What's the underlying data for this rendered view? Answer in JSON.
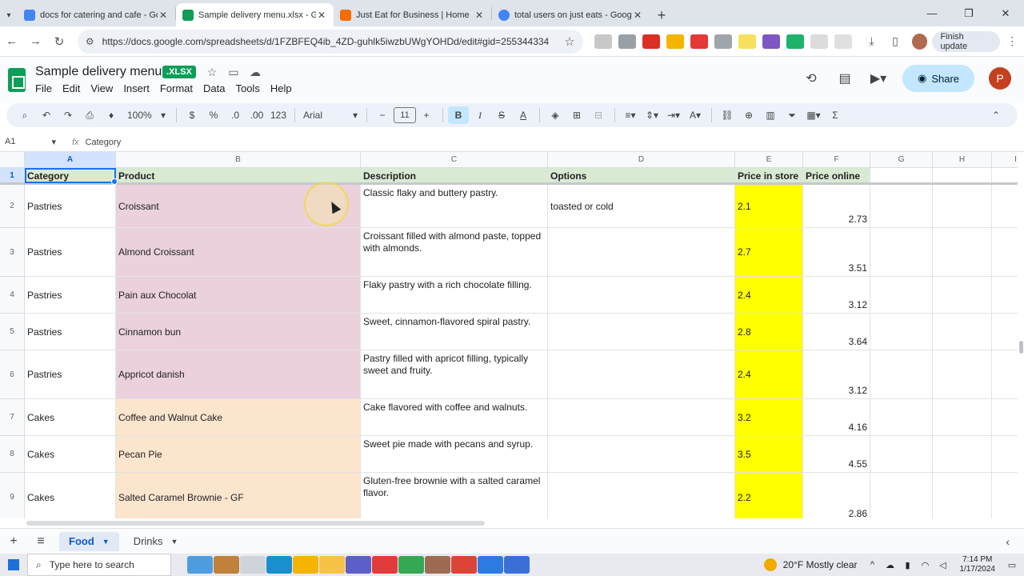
{
  "browser": {
    "tabs": [
      {
        "title": "docs for catering and cafe - Go",
        "color": "#4285f4",
        "active": false
      },
      {
        "title": "Sample delivery menu.xlsx - Go",
        "color": "#0f9d58",
        "active": true
      },
      {
        "title": "Just Eat for Business | Home",
        "color": "#f36d00",
        "active": false
      },
      {
        "title": "total users on just eats - Googl",
        "color": "#4285f4",
        "active": false
      }
    ],
    "url": "https://docs.google.com/spreadsheets/d/1FZBFEQ4ib_4ZD-guhlk5iwzbUWgYOHDd/edit#gid=255344334",
    "finish_update": "Finish update",
    "close_glyph": "✕",
    "new_tab_glyph": "+"
  },
  "doc": {
    "title": "Sample delivery menu",
    "badge": ".XLSX",
    "menu": [
      "File",
      "Edit",
      "View",
      "Insert",
      "Format",
      "Data",
      "Tools",
      "Help"
    ],
    "share_label": "Share",
    "profile_initial": "P"
  },
  "toolbar": {
    "zoom": "100%",
    "currency": "$",
    "percent": "%",
    "dec_decrease": ".0",
    "dec_increase": ".00",
    "number_format": "123",
    "font": "Arial",
    "font_size": "11",
    "bold": "B",
    "italic": "I",
    "sigma": "Σ"
  },
  "formula_bar": {
    "cell_ref": "A1",
    "content": "Category",
    "fx": "fx"
  },
  "grid": {
    "columns": [
      "A",
      "B",
      "C",
      "D",
      "E",
      "F",
      "G",
      "H",
      "I"
    ],
    "headers": [
      "Category",
      "Product",
      "Description",
      "Options",
      "Price in store",
      "Price online"
    ],
    "rows": [
      {
        "num": "2",
        "category": "Pastries",
        "product": "Croissant",
        "description": "Classic flaky and buttery pastry.",
        "options": "toasted or cold",
        "price_store": "2.1",
        "price_online": "2.73"
      },
      {
        "num": "3",
        "category": "Pastries",
        "product": "Almond Croissant",
        "description": "Croissant filled with almond paste, topped with almonds.",
        "options": "",
        "price_store": "2.7",
        "price_online": "3.51"
      },
      {
        "num": "4",
        "category": "Pastries",
        "product": "Pain aux Chocolat",
        "description": "Flaky pastry with a rich chocolate filling.",
        "options": "",
        "price_store": "2.4",
        "price_online": "3.12"
      },
      {
        "num": "5",
        "category": "Pastries",
        "product": "Cinnamon bun",
        "description": "Sweet, cinnamon-flavored spiral pastry.",
        "options": "",
        "price_store": "2.8",
        "price_online": "3.64"
      },
      {
        "num": "6",
        "category": "Pastries",
        "product": "Appricot danish",
        "description": "Pastry filled with apricot filling, typically sweet and fruity.",
        "options": "",
        "price_store": "2.4",
        "price_online": "3.12"
      },
      {
        "num": "7",
        "category": "Cakes",
        "product": "Coffee and Walnut Cake",
        "description": "Cake flavored with coffee and walnuts.",
        "options": "",
        "price_store": "3.2",
        "price_online": "4.16"
      },
      {
        "num": "8",
        "category": "Cakes",
        "product": "Pecan Pie",
        "description": "Sweet pie made with pecans and syrup.",
        "options": "",
        "price_store": "3.5",
        "price_online": "4.55"
      },
      {
        "num": "9",
        "category": "Cakes",
        "product": "Salted Caramel Brownie - GF",
        "description": "Gluten-free brownie with a salted caramel flavor.",
        "options": "",
        "price_store": "2.2",
        "price_online": "2.86"
      }
    ],
    "colors": {
      "header": "#d9ead3",
      "pastries_product": "#ead1dc",
      "cakes_product": "#fce5cd",
      "price_store": "#ffff00"
    }
  },
  "sheets": {
    "tabs": [
      "Food",
      "Drinks"
    ],
    "active": "Food"
  },
  "taskbar": {
    "search_placeholder": "Type here to search",
    "weather": "20°F  Mostly clear",
    "time": "7:14 PM",
    "date": "1/17/2024"
  }
}
